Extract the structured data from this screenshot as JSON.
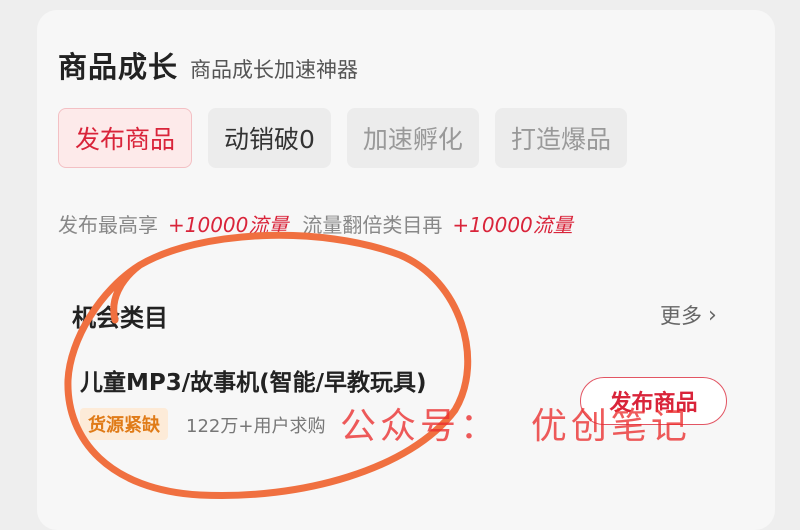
{
  "header": {
    "title": "商品成长",
    "subtitle": "商品成长加速神器"
  },
  "tabs": [
    {
      "label": "发布商品"
    },
    {
      "label": "动销破0"
    },
    {
      "label": "加速孵化"
    },
    {
      "label": "打造爆品"
    }
  ],
  "promo": {
    "text1": "发布最高享",
    "highlight1": "+10000流量",
    "text2": "流量翻倍类目再",
    "highlight2": "+10000流量"
  },
  "opportunity": {
    "heading": "机会类目",
    "more_label": "更多",
    "item": {
      "title": "儿童MP3/故事机(智能/早教玩具)",
      "badge": "货源紧缺",
      "meta": "122万+用户求购",
      "button_label": "发布商品"
    }
  },
  "watermark": "公众号：  优创笔记",
  "colors": {
    "accent": "#d9243a",
    "annotation": "#f07040",
    "badge_bg": "#fdebd8",
    "badge_text": "#e07b18"
  }
}
